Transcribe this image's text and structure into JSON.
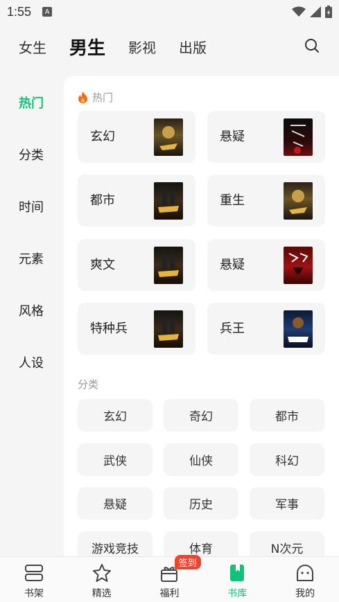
{
  "status": {
    "time": "1:55"
  },
  "topnav": {
    "tabs": [
      "女生",
      "男生",
      "影视",
      "出版"
    ],
    "active_index": 1
  },
  "sidebar": {
    "items": [
      "热门",
      "分类",
      "时间",
      "元素",
      "风格",
      "人设"
    ],
    "active_index": 0
  },
  "hot": {
    "title": "热门",
    "cards": [
      {
        "label": "玄幻",
        "cover": "cover-gold"
      },
      {
        "label": "悬疑",
        "cover": "cover-red"
      },
      {
        "label": "都市",
        "cover": "cover-soldier"
      },
      {
        "label": "重生",
        "cover": "cover-gold"
      },
      {
        "label": "爽文",
        "cover": "cover-soldier"
      },
      {
        "label": "悬疑",
        "cover": "cover-redcloth"
      },
      {
        "label": "特种兵",
        "cover": "cover-soldier"
      },
      {
        "label": "兵王",
        "cover": "cover-blue"
      }
    ]
  },
  "category": {
    "title": "分类",
    "items": [
      "玄幻",
      "奇幻",
      "都市",
      "武侠",
      "仙侠",
      "科幻",
      "悬疑",
      "历史",
      "军事",
      "游戏竞技",
      "体育",
      "N次元"
    ]
  },
  "bottombar": {
    "items": [
      {
        "label": "书架",
        "icon": "bookshelf-icon"
      },
      {
        "label": "精选",
        "icon": "star-icon"
      },
      {
        "label": "福利",
        "icon": "gift-icon",
        "badge": "签到"
      },
      {
        "label": "书库",
        "icon": "bookstore-icon"
      },
      {
        "label": "我的",
        "icon": "profile-icon"
      }
    ],
    "active_index": 3
  },
  "colors": {
    "accent": "#12c27c",
    "badge": "#f0442e"
  }
}
